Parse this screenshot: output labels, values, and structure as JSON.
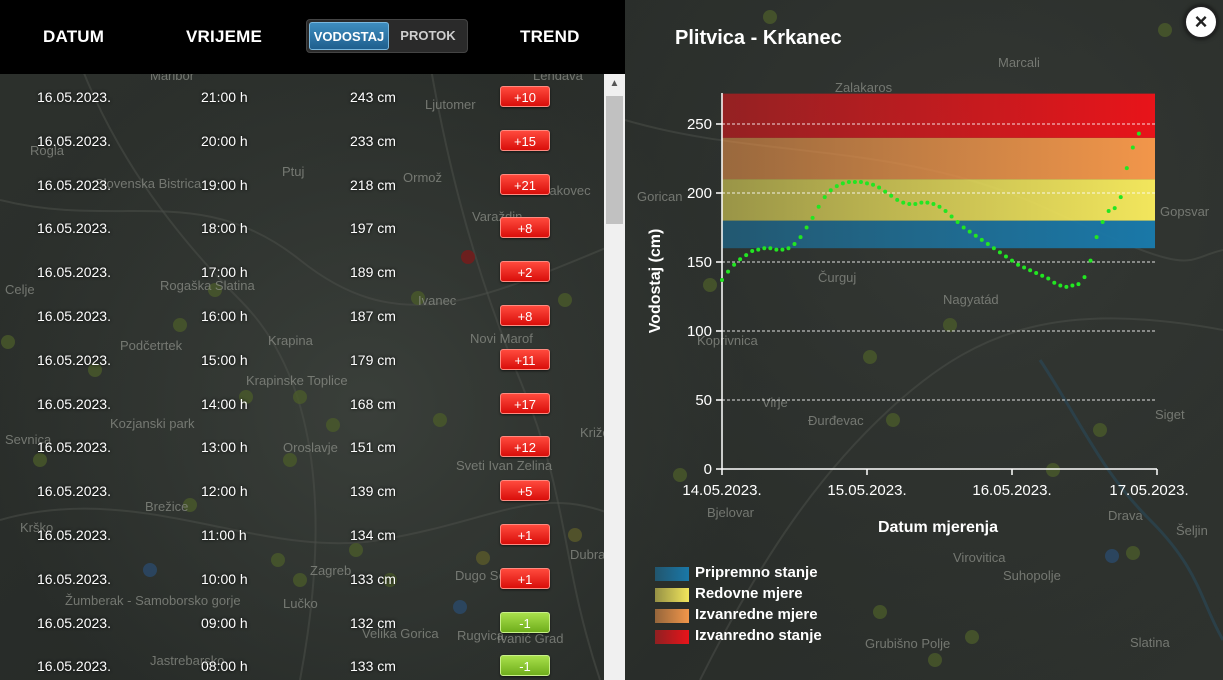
{
  "header": {
    "col_date": "DATUM",
    "col_time": "VRIJEME",
    "toggle_vodostaj": "VODOSTAJ",
    "toggle_protok": "PROTOK",
    "col_trend": "TREND"
  },
  "rows": [
    {
      "date": "16.05.2023.",
      "time": "21:00 h",
      "level": "243 cm",
      "trend": "+10",
      "direction": "up"
    },
    {
      "date": "16.05.2023.",
      "time": "20:00 h",
      "level": "233 cm",
      "trend": "+15",
      "direction": "up"
    },
    {
      "date": "16.05.2023.",
      "time": "19:00 h",
      "level": "218 cm",
      "trend": "+21",
      "direction": "up"
    },
    {
      "date": "16.05.2023.",
      "time": "18:00 h",
      "level": "197 cm",
      "trend": "+8",
      "direction": "up"
    },
    {
      "date": "16.05.2023.",
      "time": "17:00 h",
      "level": "189 cm",
      "trend": "+2",
      "direction": "up"
    },
    {
      "date": "16.05.2023.",
      "time": "16:00 h",
      "level": "187 cm",
      "trend": "+8",
      "direction": "up"
    },
    {
      "date": "16.05.2023.",
      "time": "15:00 h",
      "level": "179 cm",
      "trend": "+11",
      "direction": "up"
    },
    {
      "date": "16.05.2023.",
      "time": "14:00 h",
      "level": "168 cm",
      "trend": "+17",
      "direction": "up"
    },
    {
      "date": "16.05.2023.",
      "time": "13:00 h",
      "level": "151 cm",
      "trend": "+12",
      "direction": "up"
    },
    {
      "date": "16.05.2023.",
      "time": "12:00 h",
      "level": "139 cm",
      "trend": "+5",
      "direction": "up"
    },
    {
      "date": "16.05.2023.",
      "time": "11:00 h",
      "level": "134 cm",
      "trend": "+1",
      "direction": "up"
    },
    {
      "date": "16.05.2023.",
      "time": "10:00 h",
      "level": "133 cm",
      "trend": "+1",
      "direction": "up"
    },
    {
      "date": "16.05.2023.",
      "time": "09:00 h",
      "level": "132 cm",
      "trend": "-1",
      "direction": "down"
    },
    {
      "date": "16.05.2023.",
      "time": "08:00 h",
      "level": "133 cm",
      "trend": "-1",
      "direction": "down"
    }
  ],
  "map_labels": [
    "Maribor",
    "Rogla",
    "Slovenska Bistrica",
    "Ptuj",
    "Ormož",
    "Ljutomer",
    "Lendava",
    "Čakovec",
    "Varaždin",
    "Ivanec",
    "Novi Marof",
    "Krapina",
    "Krapinske Toplice",
    "Rogaška Slatina",
    "Podčetrtek",
    "Kozjanski park",
    "Celje",
    "Sevnica",
    "Krško",
    "Brežice",
    "Zagreb",
    "Lučko",
    "Dugo Selo",
    "Rugvica",
    "Sveti Ivan Zelina",
    "Oroslavje",
    "Žumberak - Samoborsko gorje",
    "Jastrebarsko",
    "Velika Gorica",
    "Ivanić Grad",
    "Dubrava",
    "Križevci",
    "Zalakaros",
    "Marcali",
    "Gorican",
    "Čurguj",
    "Nagyatád",
    "Koprivnica",
    "Virje",
    "Đurđevac",
    "Bjelovar",
    "Virovitica",
    "Suhopolje",
    "Slatina",
    "Grubišno Polje",
    "Siget",
    "Šeljin",
    "Gopsvar",
    "Drava"
  ],
  "chart": {
    "title": "Plitvica - Krkanec",
    "close_label": "×",
    "legend": [
      {
        "label": "Pripremno stanje",
        "color": "#1a78a8"
      },
      {
        "label": "Redovne mjere",
        "color": "#f2e65c"
      },
      {
        "label": "Izvanredne mjere",
        "color": "#f2964a"
      },
      {
        "label": "Izvanredno stanje",
        "color": "#e8141a"
      }
    ]
  },
  "chart_data": {
    "type": "scatter",
    "xlabel": "Datum mjerenja",
    "ylabel": "Vodostaj (cm)",
    "ylim": [
      0,
      250
    ],
    "yticks": [
      0,
      50,
      100,
      150,
      200,
      250
    ],
    "xticks": [
      "14.05.2023.",
      "15.05.2023.",
      "16.05.2023.",
      "17.05.2023."
    ],
    "x_start": "14.05.2023. 00:00",
    "grid": true,
    "legend_position": "bottom-left",
    "bands": [
      {
        "name": "Pripremno stanje",
        "from": 160,
        "to": 180,
        "color": "#1a78a8"
      },
      {
        "name": "Redovne mjere",
        "from": 180,
        "to": 210,
        "color": "#f2e65c"
      },
      {
        "name": "Izvanredne mjere",
        "from": 210,
        "to": 240,
        "color": "#f2964a"
      },
      {
        "name": "Izvanredno stanje",
        "from": 240,
        "to": 272,
        "color": "#e8141a"
      }
    ],
    "series": [
      {
        "color": "#22e622",
        "points": [
          {
            "x": "14.05.2023. 00:00",
            "y": 137
          },
          {
            "x": "14.05.2023. 01:00",
            "y": 143
          },
          {
            "x": "14.05.2023. 02:00",
            "y": 148
          },
          {
            "x": "14.05.2023. 03:00",
            "y": 152
          },
          {
            "x": "14.05.2023. 04:00",
            "y": 155
          },
          {
            "x": "14.05.2023. 05:00",
            "y": 158
          },
          {
            "x": "14.05.2023. 06:00",
            "y": 159
          },
          {
            "x": "14.05.2023. 07:00",
            "y": 160
          },
          {
            "x": "14.05.2023. 08:00",
            "y": 160
          },
          {
            "x": "14.05.2023. 09:00",
            "y": 159
          },
          {
            "x": "14.05.2023. 10:00",
            "y": 159
          },
          {
            "x": "14.05.2023. 11:00",
            "y": 160
          },
          {
            "x": "14.05.2023. 12:00",
            "y": 163
          },
          {
            "x": "14.05.2023. 13:00",
            "y": 168
          },
          {
            "x": "14.05.2023. 14:00",
            "y": 175
          },
          {
            "x": "14.05.2023. 15:00",
            "y": 182
          },
          {
            "x": "14.05.2023. 16:00",
            "y": 190
          },
          {
            "x": "14.05.2023. 17:00",
            "y": 197
          },
          {
            "x": "14.05.2023. 18:00",
            "y": 202
          },
          {
            "x": "14.05.2023. 19:00",
            "y": 205
          },
          {
            "x": "14.05.2023. 20:00",
            "y": 207
          },
          {
            "x": "14.05.2023. 21:00",
            "y": 208
          },
          {
            "x": "14.05.2023. 22:00",
            "y": 208
          },
          {
            "x": "14.05.2023. 23:00",
            "y": 208
          },
          {
            "x": "15.05.2023. 00:00",
            "y": 207
          },
          {
            "x": "15.05.2023. 01:00",
            "y": 206
          },
          {
            "x": "15.05.2023. 02:00",
            "y": 204
          },
          {
            "x": "15.05.2023. 03:00",
            "y": 201
          },
          {
            "x": "15.05.2023. 04:00",
            "y": 198
          },
          {
            "x": "15.05.2023. 05:00",
            "y": 195
          },
          {
            "x": "15.05.2023. 06:00",
            "y": 193
          },
          {
            "x": "15.05.2023. 07:00",
            "y": 192
          },
          {
            "x": "15.05.2023. 08:00",
            "y": 192
          },
          {
            "x": "15.05.2023. 09:00",
            "y": 193
          },
          {
            "x": "15.05.2023. 10:00",
            "y": 193
          },
          {
            "x": "15.05.2023. 11:00",
            "y": 192
          },
          {
            "x": "15.05.2023. 12:00",
            "y": 190
          },
          {
            "x": "15.05.2023. 13:00",
            "y": 187
          },
          {
            "x": "15.05.2023. 14:00",
            "y": 183
          },
          {
            "x": "15.05.2023. 15:00",
            "y": 179
          },
          {
            "x": "15.05.2023. 16:00",
            "y": 175
          },
          {
            "x": "15.05.2023. 17:00",
            "y": 172
          },
          {
            "x": "15.05.2023. 18:00",
            "y": 169
          },
          {
            "x": "15.05.2023. 19:00",
            "y": 166
          },
          {
            "x": "15.05.2023. 20:00",
            "y": 163
          },
          {
            "x": "15.05.2023. 21:00",
            "y": 160
          },
          {
            "x": "15.05.2023. 22:00",
            "y": 157
          },
          {
            "x": "15.05.2023. 23:00",
            "y": 154
          },
          {
            "x": "16.05.2023. 00:00",
            "y": 151
          },
          {
            "x": "16.05.2023. 01:00",
            "y": 148
          },
          {
            "x": "16.05.2023. 02:00",
            "y": 146
          },
          {
            "x": "16.05.2023. 03:00",
            "y": 144
          },
          {
            "x": "16.05.2023. 04:00",
            "y": 142
          },
          {
            "x": "16.05.2023. 05:00",
            "y": 140
          },
          {
            "x": "16.05.2023. 06:00",
            "y": 138
          },
          {
            "x": "16.05.2023. 07:00",
            "y": 135
          },
          {
            "x": "16.05.2023. 08:00",
            "y": 133
          },
          {
            "x": "16.05.2023. 09:00",
            "y": 132
          },
          {
            "x": "16.05.2023. 10:00",
            "y": 133
          },
          {
            "x": "16.05.2023. 11:00",
            "y": 134
          },
          {
            "x": "16.05.2023. 12:00",
            "y": 139
          },
          {
            "x": "16.05.2023. 13:00",
            "y": 151
          },
          {
            "x": "16.05.2023. 14:00",
            "y": 168
          },
          {
            "x": "16.05.2023. 15:00",
            "y": 179
          },
          {
            "x": "16.05.2023. 16:00",
            "y": 187
          },
          {
            "x": "16.05.2023. 17:00",
            "y": 189
          },
          {
            "x": "16.05.2023. 18:00",
            "y": 197
          },
          {
            "x": "16.05.2023. 19:00",
            "y": 218
          },
          {
            "x": "16.05.2023. 20:00",
            "y": 233
          },
          {
            "x": "16.05.2023. 21:00",
            "y": 243
          }
        ]
      }
    ]
  }
}
